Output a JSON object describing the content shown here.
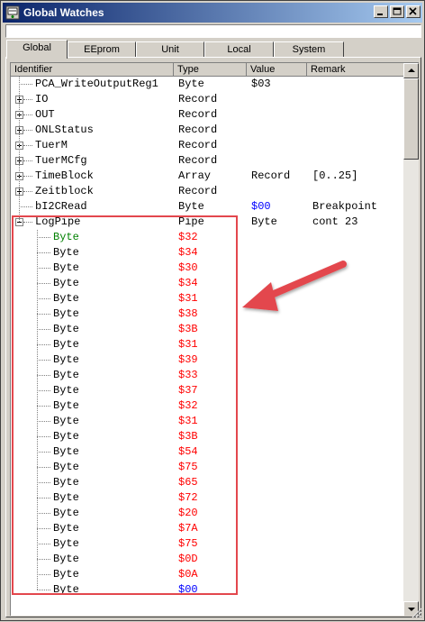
{
  "window": {
    "title": "Global Watches",
    "top_field_value": ""
  },
  "tabs": [
    "Global",
    "EEprom",
    "Unit",
    "Local",
    "System"
  ],
  "columns": {
    "identifier": "Identifier",
    "type": "Type",
    "value": "Value",
    "remark": "Remark"
  },
  "rows": [
    {
      "id": "PCA_WriteOutputReg1",
      "type": "Byte",
      "value": "$03",
      "remark": "",
      "expander": ""
    },
    {
      "id": "IO",
      "type": "Record",
      "value": "",
      "remark": "",
      "expander": "plus"
    },
    {
      "id": "OUT",
      "type": "Record",
      "value": "",
      "remark": "",
      "expander": "plus"
    },
    {
      "id": "ONLStatus",
      "type": "Record",
      "value": "",
      "remark": "",
      "expander": "plus"
    },
    {
      "id": "TuerM",
      "type": "Record",
      "value": "",
      "remark": "",
      "expander": "plus"
    },
    {
      "id": "TuerMCfg",
      "type": "Record",
      "value": "",
      "remark": "",
      "expander": "plus"
    },
    {
      "id": "TimeBlock",
      "type": "Array",
      "value": "Record",
      "remark": "[0..25]",
      "expander": "plus"
    },
    {
      "id": "Zeitblock",
      "type": "Record",
      "value": "",
      "remark": "",
      "expander": "plus"
    },
    {
      "id": "bI2CRead",
      "type": "Byte",
      "value": "$00",
      "remark": "Breakpoint",
      "expander": ""
    },
    {
      "id": "LogPipe",
      "type": "Pipe",
      "value": "Byte",
      "remark": "cont 23",
      "expander": "minus"
    }
  ],
  "children": [
    {
      "id": "Byte",
      "value": "$32"
    },
    {
      "id": "Byte",
      "value": "$34"
    },
    {
      "id": "Byte",
      "value": "$30"
    },
    {
      "id": "Byte",
      "value": "$34"
    },
    {
      "id": "Byte",
      "value": "$31"
    },
    {
      "id": "Byte",
      "value": "$38"
    },
    {
      "id": "Byte",
      "value": "$3B"
    },
    {
      "id": "Byte",
      "value": "$31"
    },
    {
      "id": "Byte",
      "value": "$39"
    },
    {
      "id": "Byte",
      "value": "$33"
    },
    {
      "id": "Byte",
      "value": "$37"
    },
    {
      "id": "Byte",
      "value": "$32"
    },
    {
      "id": "Byte",
      "value": "$31"
    },
    {
      "id": "Byte",
      "value": "$3B"
    },
    {
      "id": "Byte",
      "value": "$54"
    },
    {
      "id": "Byte",
      "value": "$75"
    },
    {
      "id": "Byte",
      "value": "$65"
    },
    {
      "id": "Byte",
      "value": "$72"
    },
    {
      "id": "Byte",
      "value": "$20"
    },
    {
      "id": "Byte",
      "value": "$7A"
    },
    {
      "id": "Byte",
      "value": "$75"
    },
    {
      "id": "Byte",
      "value": "$0D"
    },
    {
      "id": "Byte",
      "value": "$0A"
    },
    {
      "id": "Byte",
      "value": "$00"
    }
  ],
  "colors": {
    "title_start": "#0a246a",
    "title_end": "#a6caf0",
    "value_blue": "#0000ff",
    "child_red": "#ff0000",
    "first_child_green": "#008000",
    "annotation_red": "#e3474d"
  }
}
